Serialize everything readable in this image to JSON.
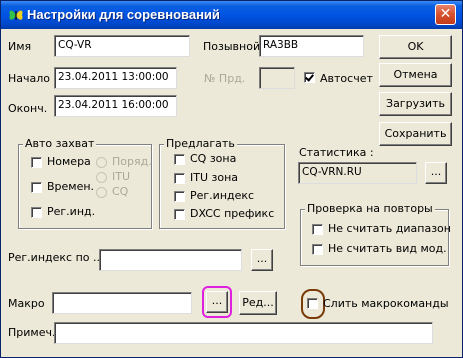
{
  "window": {
    "title": "Настройки для соревнований",
    "close_glyph": "✕",
    "accent_color": "#0054e3"
  },
  "fields": {
    "name_label": "Имя",
    "name_value": "CQ-VR",
    "callsign_label": "Позывной",
    "callsign_value": "RA3BB",
    "start_label": "Начало",
    "start_value": "23.04.2011 13:00:00",
    "end_label": "Оконч.",
    "end_value": "23.04.2011 16:00:00",
    "prd_label": "№ Прд.",
    "prd_value": "",
    "autocount_label": "Автосчет",
    "autocount_checked": true
  },
  "buttons": {
    "ok": "OK",
    "cancel": "Отмена",
    "load": "Загрузить",
    "save": "Сохранить",
    "stats_browse": "...",
    "reg_browse": "...",
    "macro_browse": "...",
    "macro_edit": "Ред..."
  },
  "auto_capture": {
    "title": "Авто захват",
    "numbers": "Номера",
    "order": "Поряд.",
    "time": "Времен.",
    "itu": "ITU",
    "cq": "CQ",
    "reg_ind": "Рег.инд."
  },
  "suggest": {
    "title": "Предлагать",
    "cq_zone": "CQ зона",
    "itu_zone": "ITU зона",
    "reg_index": "Рег.индекс",
    "dxcc_prefix": "DXCC префикс"
  },
  "statistics": {
    "label": "Статистика :",
    "value": "CQ-VRN.RU"
  },
  "duplicates": {
    "title": "Проверка на повторы",
    "ignore_band": "Не считать диапазон",
    "ignore_mode": "Не считать вид мод."
  },
  "reg_index": {
    "label": "Рег.индекс по ...",
    "value": ""
  },
  "macro": {
    "label": "Макро",
    "value": "",
    "merge_label": "Слить макрокоманды",
    "merge_checked": false
  },
  "note": {
    "label": "Примеч.",
    "value": ""
  },
  "highlights": {
    "browse_ring_color": "#e020e0",
    "merge_ring_color": "#7a3a0a"
  }
}
